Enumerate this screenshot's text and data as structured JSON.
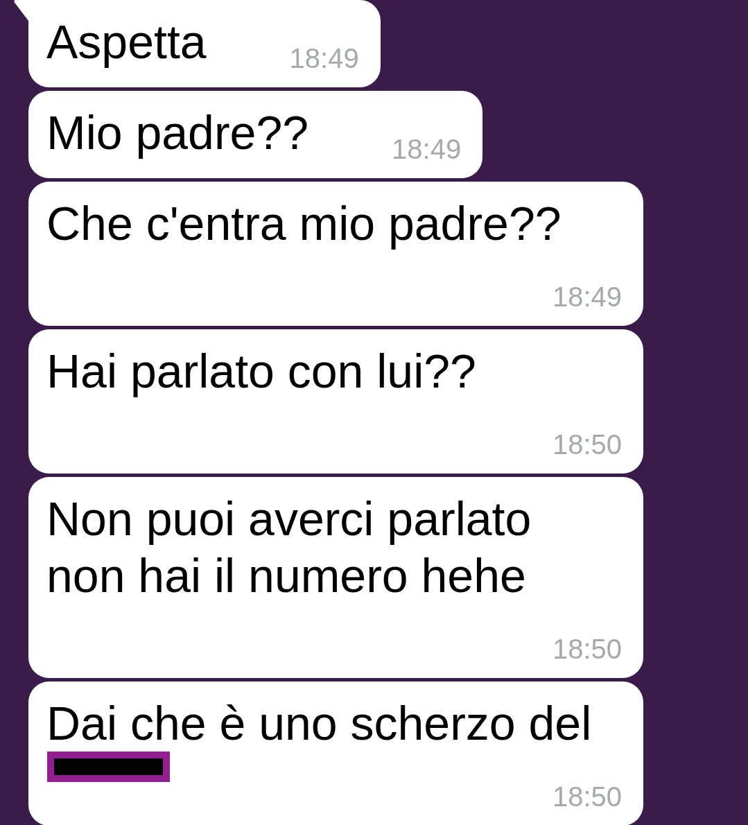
{
  "messages": [
    {
      "text": "Aspetta",
      "time": "18:49",
      "tail": true,
      "redacted": false
    },
    {
      "text": "Mio padre??",
      "time": "18:49",
      "tail": false,
      "redacted": false
    },
    {
      "text": "Che c'entra mio padre??",
      "time": "18:49",
      "tail": false,
      "redacted": false
    },
    {
      "text": "Hai parlato con lui??",
      "time": "18:50",
      "tail": false,
      "redacted": false
    },
    {
      "text": "Non puoi averci parlato non hai il numero hehe",
      "time": "18:50",
      "tail": false,
      "redacted": false
    },
    {
      "text": "Dai che è uno scherzo del",
      "time": "18:50",
      "tail": false,
      "redacted": true
    }
  ]
}
